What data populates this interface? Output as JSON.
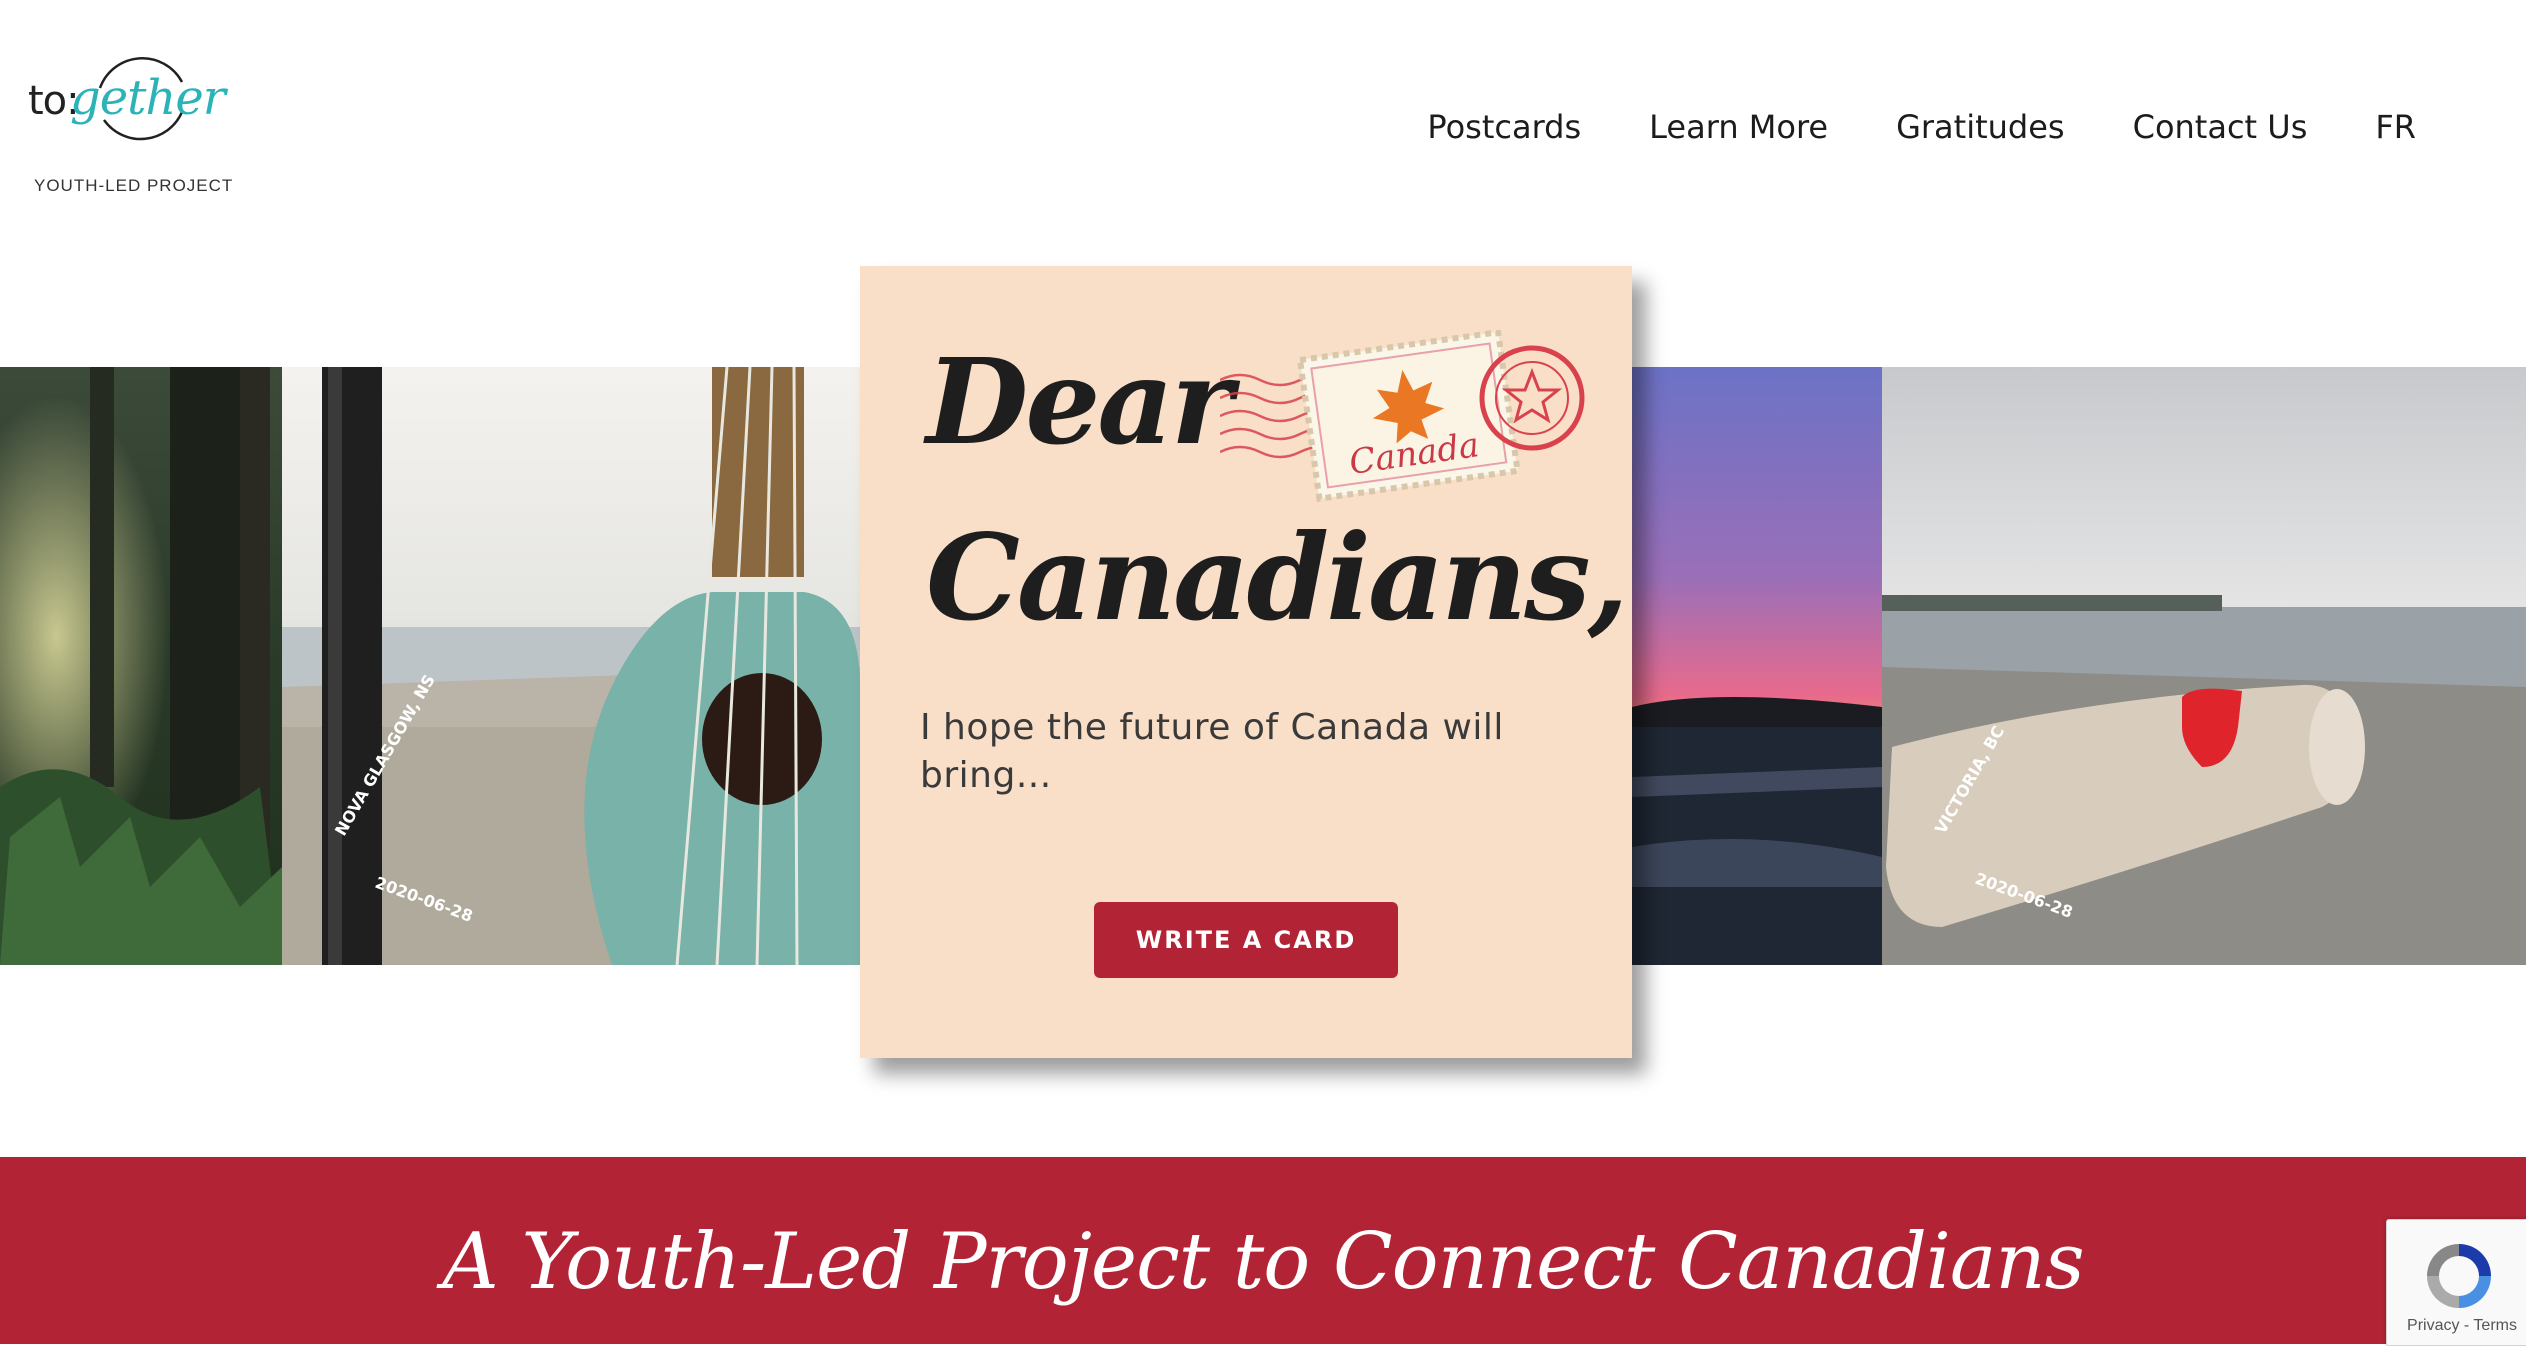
{
  "header": {
    "logo": {
      "prefix": "to:",
      "word": "gether",
      "subtitle": "YOUTH-LED PROJECT"
    },
    "nav": [
      "Postcards",
      "Learn More",
      "Gratitudes",
      "Contact Us",
      "FR"
    ]
  },
  "hero": {
    "card": {
      "title": "Dear Canadians,",
      "body": "I hope the future of Canada will bring...",
      "button": "WRITE A CARD",
      "stamp_text": "Canada"
    },
    "photos": [
      {
        "caption": "NOVA GLASGOW, NS",
        "date": "2020-06-28"
      },
      {
        "caption": "VICTORIA, BC",
        "date": "2020-06-28"
      }
    ]
  },
  "banner": {
    "title": "A Youth-Led Project to Connect Canadians"
  },
  "recaptcha": {
    "links": "Privacy - Terms"
  },
  "colors": {
    "accent": "#b22435",
    "card": "#f9dfc8",
    "teal": "#2bb3b8"
  }
}
